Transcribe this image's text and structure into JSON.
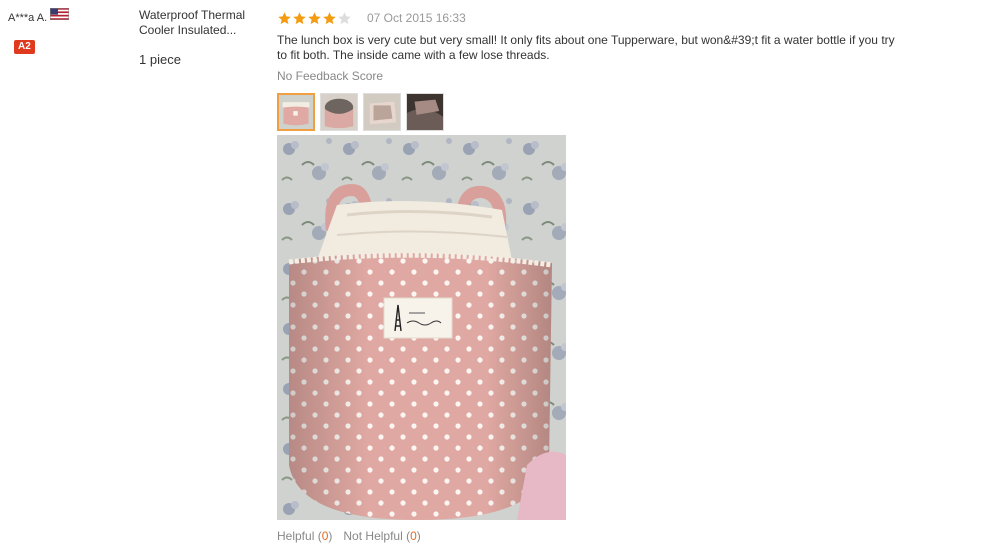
{
  "reviewer": {
    "name": "A***a A.",
    "country_flag": "us-flag-icon",
    "level_badge": "A2",
    "badge_color": "#e03a1e"
  },
  "product": {
    "name": "Waterproof Thermal Cooler Insulated...",
    "quantity": "1 piece"
  },
  "review": {
    "rating": 4,
    "rating_max": 5,
    "star_color": "#f39c12",
    "date": "07 Oct 2015 16:33",
    "text": "The lunch box is very cute but very small! It only fits about one Tupperware, but won&#39;t fit a water bottle if you try to fit both. The inside came with a few lose threads.",
    "feedback_score": "No Feedback Score",
    "thumbnails_count": 4,
    "selected_thumbnail": 1
  },
  "actions": {
    "helpful_label": "Helpful",
    "helpful_open": "(",
    "helpful_count": "0",
    "helpful_close": ")",
    "not_helpful_label": "Not Helpful",
    "not_helpful_open": "(",
    "not_helpful_count": "0",
    "not_helpful_close": ")",
    "count_color": "#e76a1d"
  }
}
